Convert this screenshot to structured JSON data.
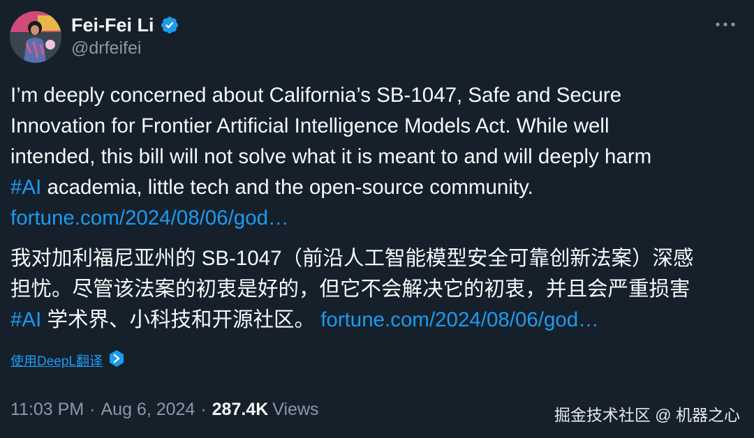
{
  "author": {
    "display_name": "Fei-Fei Li",
    "handle": "@drfeifei",
    "verified": true
  },
  "tweet": {
    "en_lines": {
      "l1": "I’m deeply concerned about California’s SB-1047, Safe and Secure",
      "l2": "Innovation for Frontier Artificial Intelligence Models Act. While well",
      "l3": "intended, this bill will not solve what it is meant to and will deeply harm",
      "l4_hashtag": "#AI",
      "l4_text": " academia, little tech and the open-source community.",
      "l5_link": "fortune.com/2024/08/06/god…"
    },
    "zh_lines": {
      "l1": "我对加利福尼亚州的 SB-1047（前沿人工智能模型安全可靠创新法案）深感",
      "l2": "担忧。尽管该法案的初衷是好的，但它不会解决它的初衷，并且会严重损害",
      "l3_hashtag": "#AI",
      "l3_text": " 学术界、小科技和开源社区。 ",
      "l3_link": "fortune.com/2024/08/06/god…"
    }
  },
  "translate": {
    "label": "使用DeepL翻译"
  },
  "meta": {
    "time": "11:03 PM",
    "sep1": "·",
    "date": "Aug 6, 2024",
    "sep2": "·",
    "views_count": "287.4K",
    "views_label": "Views"
  },
  "watermark": "掘金技术社区 @ 机器之心",
  "icons": {
    "verified": "verified-badge-icon",
    "more": "more-horizontal-icon",
    "deepl": "deepl-logo-icon"
  },
  "colors": {
    "background": "#15202b",
    "text": "#f7f9f9",
    "secondary": "#8b98a5",
    "accent": "#1d9bf0"
  }
}
